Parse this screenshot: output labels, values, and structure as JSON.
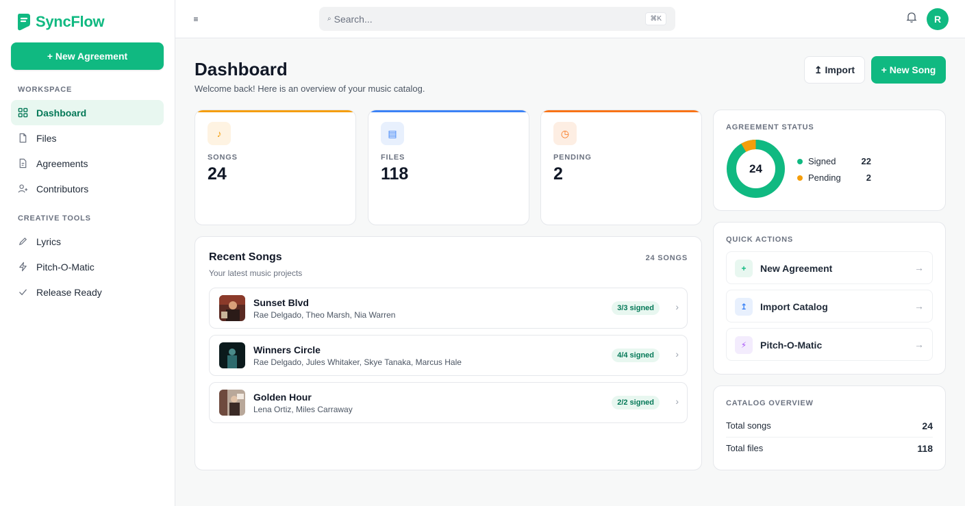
{
  "app": {
    "name": "SyncFlow"
  },
  "sidebar": {
    "new_agreement_label": "+ New Agreement",
    "workspace_label": "WORKSPACE",
    "workspace_items": [
      {
        "label": "Dashboard",
        "icon": "grid-icon",
        "active": true
      },
      {
        "label": "Files",
        "icon": "file-icon"
      },
      {
        "label": "Agreements",
        "icon": "document-icon"
      },
      {
        "label": "Contributors",
        "icon": "users-icon"
      }
    ],
    "tools_label": "CREATIVE TOOLS",
    "tools_items": [
      {
        "label": "Lyrics",
        "icon": "pen-icon"
      },
      {
        "label": "Pitch-O-Matic",
        "icon": "bolt-icon"
      },
      {
        "label": "Release Ready",
        "icon": "check-icon"
      }
    ]
  },
  "topbar": {
    "search_placeholder": "Search...",
    "search_shortcut": "⌘K",
    "avatar_initial": "R"
  },
  "header": {
    "title": "Dashboard",
    "subtitle": "Welcome back! Here is an overview of your music catalog.",
    "import_label": "↥ Import",
    "new_song_label": "+ New Song"
  },
  "stats": [
    {
      "label": "SONGS",
      "value": "24",
      "icon": "music-note-icon",
      "glyph": "♪",
      "color": "#f59e0b"
    },
    {
      "label": "FILES",
      "value": "118",
      "icon": "file-stack-icon",
      "glyph": "▤",
      "color": "#3b82f6"
    },
    {
      "label": "PENDING",
      "value": "2",
      "icon": "clock-icon",
      "glyph": "◷",
      "color": "#f97316"
    }
  ],
  "recent": {
    "title": "Recent Songs",
    "subtitle": "Your latest music projects",
    "count_label": "24 SONGS",
    "songs": [
      {
        "title": "Sunset Blvd",
        "artists": "Rae Delgado, Theo Marsh, Nia Warren",
        "badge": "3/3 signed"
      },
      {
        "title": "Winners Circle",
        "artists": "Rae Delgado, Jules Whitaker, Skye Tanaka, Marcus Hale",
        "badge": "4/4 signed"
      },
      {
        "title": "Golden Hour",
        "artists": "Lena Ortiz, Miles Carraway",
        "badge": "2/2 signed"
      }
    ]
  },
  "agreement_status": {
    "label": "AGREEMENT STATUS",
    "total": "24",
    "signed_label": "Signed",
    "signed_value": 22,
    "pending_label": "Pending",
    "pending_value": 2,
    "signed_color": "#10b981",
    "pending_color": "#f59e0b"
  },
  "quick_actions": {
    "label": "QUICK ACTIONS",
    "items": [
      {
        "label": "New Agreement",
        "icon": "plus-icon",
        "glyph": "+"
      },
      {
        "label": "Import Catalog",
        "icon": "upload-icon",
        "glyph": "↥"
      },
      {
        "label": "Pitch-O-Matic",
        "icon": "bolt-icon",
        "glyph": "⚡"
      }
    ]
  },
  "catalog_overview": {
    "label": "CATALOG OVERVIEW",
    "total_songs_label": "Total songs",
    "total_songs_value": "24",
    "total_files_label": "Total files",
    "total_files_value": "118"
  },
  "colors": {
    "accent": "#10b981"
  }
}
